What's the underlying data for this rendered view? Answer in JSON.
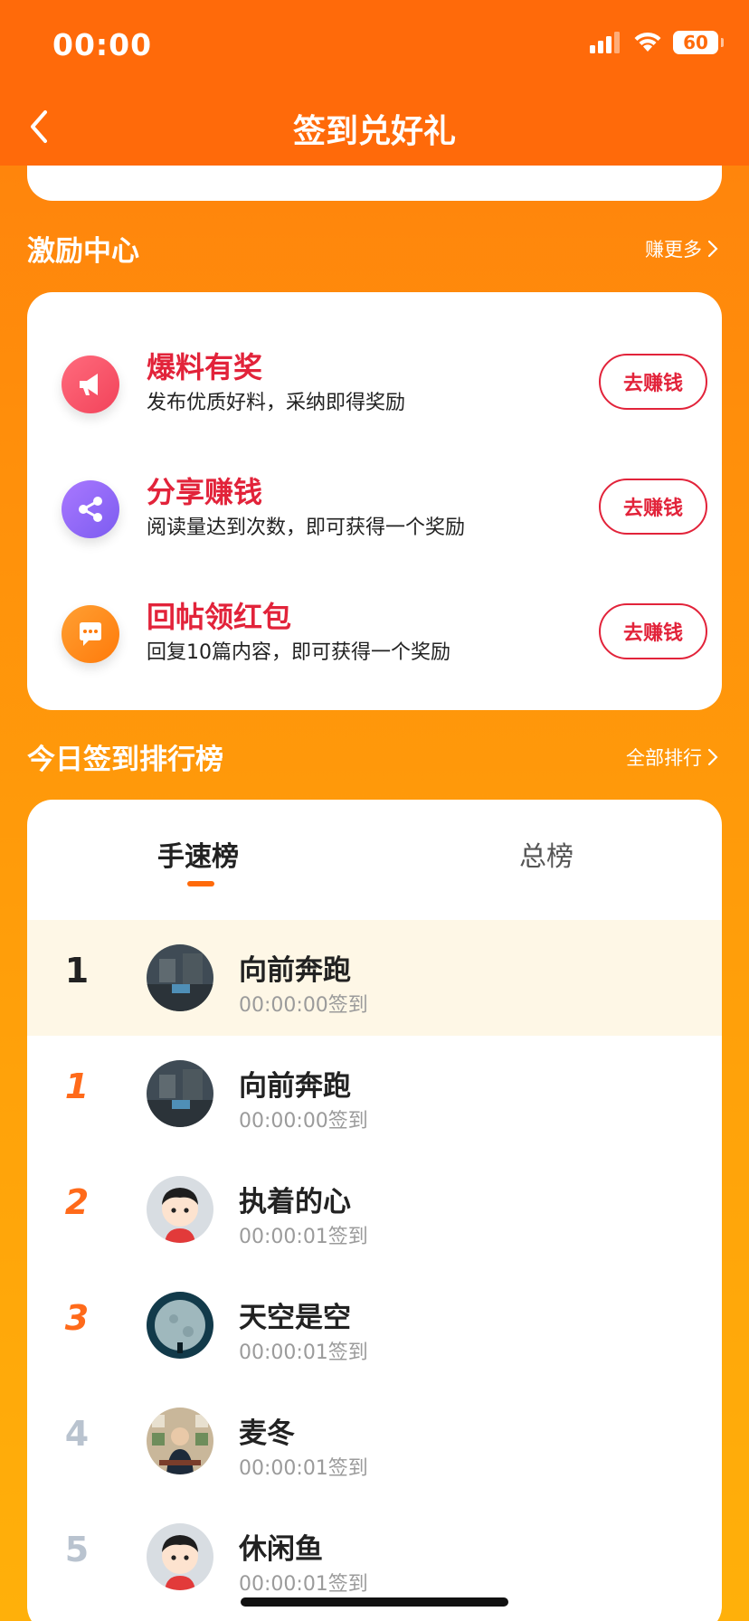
{
  "status_bar": {
    "time": "00:00",
    "battery": "60"
  },
  "header": {
    "title": "签到兑好礼"
  },
  "incentive": {
    "title": "激励中心",
    "more": "赚更多",
    "tasks": [
      {
        "title": "爆料有奖",
        "desc": "发布优质好料，采纳即得奖励",
        "button": "去赚钱",
        "icon": "megaphone-icon",
        "color": "#f2435a"
      },
      {
        "title": "分享赚钱",
        "desc": "阅读量达到次数，即可获得一个奖励",
        "button": "去赚钱",
        "icon": "share-icon",
        "color": "#8b5cf6"
      },
      {
        "title": "回帖领红包",
        "desc": "回复10篇内容，即可获得一个奖励",
        "button": "去赚钱",
        "icon": "comment-icon",
        "color": "#ff7a0a"
      }
    ]
  },
  "ranking": {
    "title": "今日签到排行榜",
    "more": "全部排行",
    "tabs": [
      "手速榜",
      "总榜"
    ],
    "my_rank": {
      "rank": "1",
      "name": "向前奔跑",
      "time": "00:00:00签到"
    },
    "rows": [
      {
        "rank": "1",
        "name": "向前奔跑",
        "time": "00:00:00签到"
      },
      {
        "rank": "2",
        "name": "执着的心",
        "time": "00:00:01签到"
      },
      {
        "rank": "3",
        "name": "天空是空",
        "time": "00:00:01签到"
      },
      {
        "rank": "4",
        "name": "麦冬",
        "time": "00:00:01签到"
      },
      {
        "rank": "5",
        "name": "休闲鱼",
        "time": "00:00:01签到"
      }
    ]
  },
  "colors": {
    "header": "#ff6a0a",
    "accent_red": "#e2233a",
    "tab_indicator": "#ff6a0a",
    "highlight_row": "#fef7e6"
  }
}
